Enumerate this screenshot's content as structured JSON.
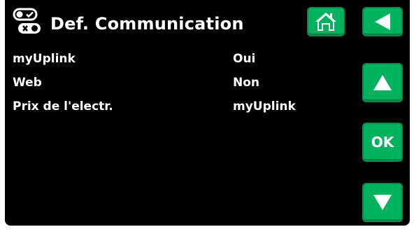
{
  "header": {
    "title": "Def. Communication",
    "icon": "settings-toggle-icon"
  },
  "nav": {
    "home_icon": "home-icon",
    "back_icon": "back-arrow-icon",
    "up_icon": "up-arrow-icon",
    "ok_label": "OK",
    "down_icon": "down-arrow-icon"
  },
  "settings": {
    "rows": [
      {
        "label": "myUplink",
        "value": "Oui"
      },
      {
        "label": "Web",
        "value": "Non"
      },
      {
        "label": "Prix de l'electr.",
        "value": "myUplink"
      }
    ]
  },
  "colors": {
    "background": "#000000",
    "button": "#00b15e",
    "text": "#ffffff"
  }
}
